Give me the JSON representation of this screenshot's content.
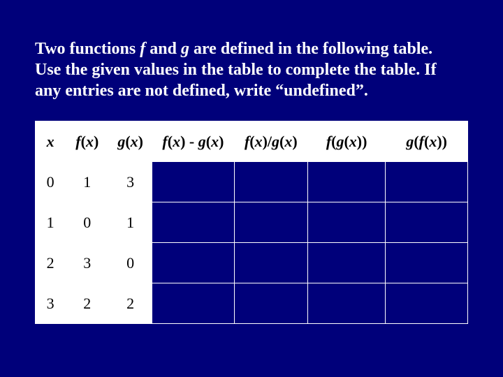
{
  "problem": {
    "html": "Two functions <span class=\"fn\">f</span> and <span class=\"fn\">g</span> are defined in the following table.  Use the given values in the table to complete the table.  If any entries are not defined, write “undefined”."
  },
  "headers": {
    "x_html": "<span class=\"fn\">x</span>",
    "fx_html": "<span class=\"fn\">f</span>(<span class=\"fn\">x</span>)",
    "gx_html": "<span class=\"fn\">g</span>(<span class=\"fn\">x</span>)",
    "diff_html": "<span class=\"fn\">f</span>(<span class=\"fn\">x</span>) - <span class=\"fn\">g</span>(<span class=\"fn\">x</span>)",
    "div_html": "<span class=\"fn\">f</span>(<span class=\"fn\">x</span>)/<span class=\"fn\">g</span>(<span class=\"fn\">x</span>)",
    "fg_html": "<span class=\"fn\">f</span>(<span class=\"fn\">g</span>(<span class=\"fn\">x</span>))",
    "gf_html": "<span class=\"fn\">g</span>(<span class=\"fn\">f</span>(<span class=\"fn\">x</span>))"
  },
  "rows": [
    {
      "x": "0",
      "fx": "1",
      "gx": "3",
      "diff": "",
      "div": "",
      "fg": "",
      "gf": ""
    },
    {
      "x": "1",
      "fx": "0",
      "gx": "1",
      "diff": "",
      "div": "",
      "fg": "",
      "gf": ""
    },
    {
      "x": "2",
      "fx": "3",
      "gx": "0",
      "diff": "",
      "div": "",
      "fg": "",
      "gf": ""
    },
    {
      "x": "3",
      "fx": "2",
      "gx": "2",
      "diff": "",
      "div": "",
      "fg": "",
      "gf": ""
    }
  ]
}
